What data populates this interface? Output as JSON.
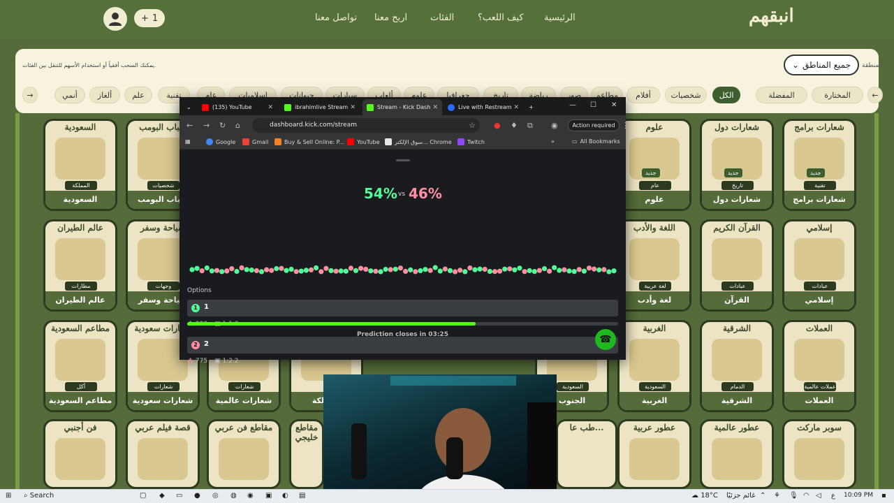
{
  "site": {
    "logo": "انبقهم",
    "nav": [
      "الرئيسية",
      "كيف اللعب؟",
      "الفئات",
      "اربح معنا",
      "تواصل معنا"
    ],
    "counter": "1",
    "plus": "+"
  },
  "filters": {
    "region_label": "المنطقة:",
    "region_value": "جميع المناطق",
    "hint": "يمكنك السحب أفقياً أو استخدام الأسهم للتنقل بين الفئات.",
    "chips": [
      "المختارة",
      "المفضلة",
      "الكل",
      "شخصيات",
      "أفلام",
      "مطاعم",
      "صور",
      "رياضة",
      "تاريخ",
      "جغرافيا",
      "علوم",
      "ألعاب",
      "سيارات",
      "حيوانات",
      "إسلاميات",
      "عام",
      "تقنية",
      "علم",
      "ألغاز",
      "أنمي"
    ]
  },
  "cards": [
    {
      "title": "شعارات برامج",
      "tag": "تقنية",
      "footer": "شعارات برامج",
      "badge": "جديد"
    },
    {
      "title": "شعارات دول",
      "tag": "تاريخ",
      "footer": "شعارات دول",
      "badge": "جديد"
    },
    {
      "title": "علوم",
      "tag": "عام",
      "footer": "علوم",
      "badge": "جديد"
    },
    {
      "title": "السعودية",
      "tag": "المملكة",
      "footer": "السعودية",
      "badge": ""
    },
    {
      "title": "شباب البومب",
      "tag": "شخصيات",
      "footer": "شباب البومب",
      "badge": ""
    },
    {
      "title": "إسلامي",
      "tag": "عبادات",
      "footer": "إسلامي",
      "badge": ""
    },
    {
      "title": "القرآن الكريم",
      "tag": "عبادات",
      "footer": "القرآن",
      "badge": ""
    },
    {
      "title": "اللغة والأدب",
      "tag": "لغة عربية",
      "footer": "لغة وأدب",
      "badge": ""
    },
    {
      "title": "عالم الطيران",
      "tag": "مطارات",
      "footer": "عالم الطيران",
      "badge": ""
    },
    {
      "title": "سياحة وسفر",
      "tag": "وجهات سياحية",
      "footer": "سياحة وسفر",
      "badge": ""
    },
    {
      "title": "العملات",
      "tag": "عملات عالمية",
      "footer": "العملات",
      "badge": ""
    },
    {
      "title": "الشرقية",
      "tag": "الدمام",
      "footer": "الشرقية",
      "badge": ""
    },
    {
      "title": "الغربية",
      "tag": "السعودية",
      "footer": "الغربية",
      "badge": ""
    },
    {
      "title": "",
      "tag": "السعودية",
      "footer": "الجنوب",
      "badge": ""
    },
    {
      "title": "",
      "tag": "",
      "footer": "المملكة",
      "badge": ""
    },
    {
      "title": "",
      "tag": "شعارات",
      "footer": "شعارات عالمية",
      "badge": ""
    },
    {
      "title": "شعارات سعودية",
      "tag": "شعارات",
      "footer": "شعارات سعودية",
      "badge": ""
    },
    {
      "title": "مطاعم السعودية",
      "tag": "أكل",
      "footer": "مطاعم السعودية",
      "badge": ""
    },
    {
      "title": "سوبر ماركت",
      "tag": "",
      "footer": "",
      "badge": ""
    },
    {
      "title": "عطور عالمية",
      "tag": "",
      "footer": "",
      "badge": ""
    },
    {
      "title": "عطور عربية",
      "tag": "",
      "footer": "",
      "badge": ""
    },
    {
      "title": "طب عا...",
      "tag": "",
      "footer": "",
      "badge": ""
    },
    {
      "title": "مقاطع خليجي",
      "tag": "",
      "footer": "",
      "badge": ""
    },
    {
      "title": "مقاطع فن عربي",
      "tag": "",
      "footer": "",
      "badge": ""
    },
    {
      "title": "قصة فيلم عربي",
      "tag": "",
      "footer": "",
      "badge": ""
    },
    {
      "title": "فن أجنبي",
      "tag": "",
      "footer": "",
      "badge": ""
    }
  ],
  "browser": {
    "tabs": [
      {
        "label": "(135) YouTube",
        "color": "#ff0000"
      },
      {
        "label": "ibrahimlive Stream",
        "color": "#53fc18"
      },
      {
        "label": "Stream - Kick Dash",
        "color": "#53fc18"
      },
      {
        "label": "Live with Restream",
        "color": "#2b6bff"
      }
    ],
    "url": "dashboard.kick.com/stream",
    "action_required": "Action required",
    "bookmarks": [
      "Google",
      "Gmail",
      "Buy & Sell Online: P...",
      "YouTube",
      "سوق الإلكتر... Chrome",
      "Twitch",
      "All Bookmarks"
    ]
  },
  "prediction": {
    "pct_a": "54%",
    "pct_b": "46%",
    "vs": "vs",
    "pct_a_value": 54,
    "color_a": "#53fc98",
    "color_b": "#ff8fa3",
    "options_label": "Options",
    "options": [
      {
        "num": "1",
        "label": "1",
        "votes": "920",
        "ratio": "1:1.8",
        "color": "#53fc98"
      },
      {
        "num": "2",
        "label": "2",
        "votes": "775",
        "ratio": "1:2.2",
        "color": "#ff8fa3"
      }
    ],
    "time_progress": 0.67,
    "closes": "Prediction closes in 03:25"
  },
  "taskbar": {
    "search": "Search",
    "weather": "18°C",
    "weather_desc": "غائم جزئيًا",
    "lang": "ع",
    "time": "10:09 PM"
  }
}
